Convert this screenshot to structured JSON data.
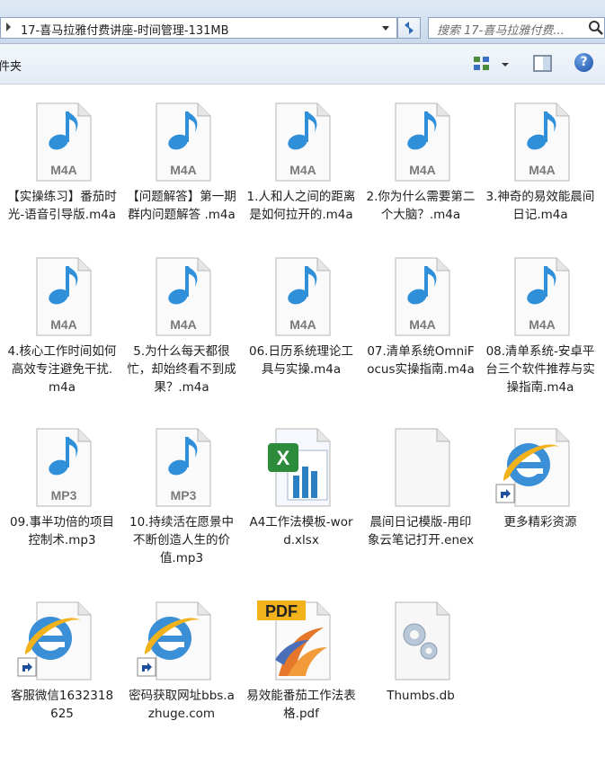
{
  "window": {
    "address_path": "17-喜马拉雅付费讲座-时间管理-131MB",
    "search_placeholder": "搜索 17-喜马拉雅付费...",
    "toolbar_left_label": "件夹"
  },
  "items": [
    {
      "label": "【实操练习】番茄时光-语音引导版.m4a",
      "type": "audio",
      "badge": "M4A"
    },
    {
      "label": "【问题解答】第一期群内问题解答 .m4a",
      "type": "audio",
      "badge": "M4A"
    },
    {
      "label": "1.人和人之间的距离是如何拉开的.m4a",
      "type": "audio",
      "badge": "M4A"
    },
    {
      "label": "2.你为什么需要第二个大脑？.m4a",
      "type": "audio",
      "badge": "M4A"
    },
    {
      "label": "3.神奇的易效能晨间日记.m4a",
      "type": "audio",
      "badge": "M4A"
    },
    {
      "label": "4.核心工作时间如何高效专注避免干扰.m4a",
      "type": "audio",
      "badge": "M4A"
    },
    {
      "label": "5.为什么每天都很忙，却始终看不到成果？.m4a",
      "type": "audio",
      "badge": "M4A"
    },
    {
      "label": "06.日历系统理论工具与实操.m4a",
      "type": "audio",
      "badge": "M4A"
    },
    {
      "label": "07.清单系统OmniFocus实操指南.m4a",
      "type": "audio",
      "badge": "M4A"
    },
    {
      "label": "08.清单系统-安卓平台三个软件推荐与实操指南.m4a",
      "type": "audio",
      "badge": "M4A"
    },
    {
      "label": "09.事半功倍的项目控制术.mp3",
      "type": "audio",
      "badge": "MP3"
    },
    {
      "label": "10.持续活在愿景中不断创造人生的价值.mp3",
      "type": "audio",
      "badge": "MP3"
    },
    {
      "label": "A4工作法模板-word.xlsx",
      "type": "excel",
      "badge": ""
    },
    {
      "label": "晨间日记模版-用印象云笔记打开.enex",
      "type": "blank",
      "badge": ""
    },
    {
      "label": "更多精彩资源",
      "type": "ie",
      "badge": ""
    },
    {
      "label": "客服微信1632318625",
      "type": "ie",
      "badge": ""
    },
    {
      "label": "密码获取网址bbs.azhuge.com",
      "type": "ie",
      "badge": ""
    },
    {
      "label": "易效能番茄工作法表格.pdf",
      "type": "pdf",
      "badge": "PDF"
    },
    {
      "label": "Thumbs.db",
      "type": "db",
      "badge": ""
    }
  ]
}
